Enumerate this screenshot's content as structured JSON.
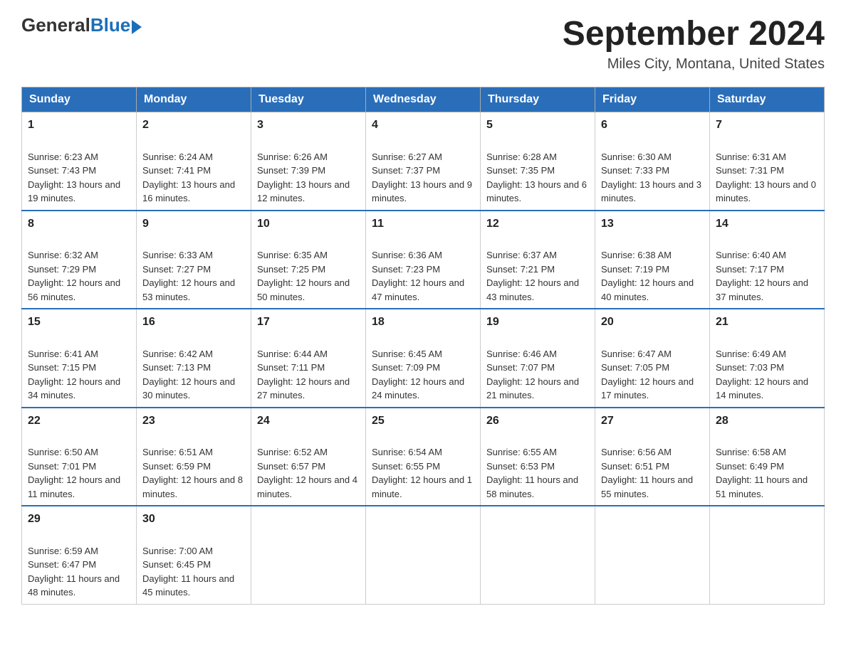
{
  "logo": {
    "general": "General",
    "blue": "Blue"
  },
  "title": "September 2024",
  "location": "Miles City, Montana, United States",
  "days_of_week": [
    "Sunday",
    "Monday",
    "Tuesday",
    "Wednesday",
    "Thursday",
    "Friday",
    "Saturday"
  ],
  "weeks": [
    [
      {
        "day": "1",
        "sunrise": "Sunrise: 6:23 AM",
        "sunset": "Sunset: 7:43 PM",
        "daylight": "Daylight: 13 hours and 19 minutes."
      },
      {
        "day": "2",
        "sunrise": "Sunrise: 6:24 AM",
        "sunset": "Sunset: 7:41 PM",
        "daylight": "Daylight: 13 hours and 16 minutes."
      },
      {
        "day": "3",
        "sunrise": "Sunrise: 6:26 AM",
        "sunset": "Sunset: 7:39 PM",
        "daylight": "Daylight: 13 hours and 12 minutes."
      },
      {
        "day": "4",
        "sunrise": "Sunrise: 6:27 AM",
        "sunset": "Sunset: 7:37 PM",
        "daylight": "Daylight: 13 hours and 9 minutes."
      },
      {
        "day": "5",
        "sunrise": "Sunrise: 6:28 AM",
        "sunset": "Sunset: 7:35 PM",
        "daylight": "Daylight: 13 hours and 6 minutes."
      },
      {
        "day": "6",
        "sunrise": "Sunrise: 6:30 AM",
        "sunset": "Sunset: 7:33 PM",
        "daylight": "Daylight: 13 hours and 3 minutes."
      },
      {
        "day": "7",
        "sunrise": "Sunrise: 6:31 AM",
        "sunset": "Sunset: 7:31 PM",
        "daylight": "Daylight: 13 hours and 0 minutes."
      }
    ],
    [
      {
        "day": "8",
        "sunrise": "Sunrise: 6:32 AM",
        "sunset": "Sunset: 7:29 PM",
        "daylight": "Daylight: 12 hours and 56 minutes."
      },
      {
        "day": "9",
        "sunrise": "Sunrise: 6:33 AM",
        "sunset": "Sunset: 7:27 PM",
        "daylight": "Daylight: 12 hours and 53 minutes."
      },
      {
        "day": "10",
        "sunrise": "Sunrise: 6:35 AM",
        "sunset": "Sunset: 7:25 PM",
        "daylight": "Daylight: 12 hours and 50 minutes."
      },
      {
        "day": "11",
        "sunrise": "Sunrise: 6:36 AM",
        "sunset": "Sunset: 7:23 PM",
        "daylight": "Daylight: 12 hours and 47 minutes."
      },
      {
        "day": "12",
        "sunrise": "Sunrise: 6:37 AM",
        "sunset": "Sunset: 7:21 PM",
        "daylight": "Daylight: 12 hours and 43 minutes."
      },
      {
        "day": "13",
        "sunrise": "Sunrise: 6:38 AM",
        "sunset": "Sunset: 7:19 PM",
        "daylight": "Daylight: 12 hours and 40 minutes."
      },
      {
        "day": "14",
        "sunrise": "Sunrise: 6:40 AM",
        "sunset": "Sunset: 7:17 PM",
        "daylight": "Daylight: 12 hours and 37 minutes."
      }
    ],
    [
      {
        "day": "15",
        "sunrise": "Sunrise: 6:41 AM",
        "sunset": "Sunset: 7:15 PM",
        "daylight": "Daylight: 12 hours and 34 minutes."
      },
      {
        "day": "16",
        "sunrise": "Sunrise: 6:42 AM",
        "sunset": "Sunset: 7:13 PM",
        "daylight": "Daylight: 12 hours and 30 minutes."
      },
      {
        "day": "17",
        "sunrise": "Sunrise: 6:44 AM",
        "sunset": "Sunset: 7:11 PM",
        "daylight": "Daylight: 12 hours and 27 minutes."
      },
      {
        "day": "18",
        "sunrise": "Sunrise: 6:45 AM",
        "sunset": "Sunset: 7:09 PM",
        "daylight": "Daylight: 12 hours and 24 minutes."
      },
      {
        "day": "19",
        "sunrise": "Sunrise: 6:46 AM",
        "sunset": "Sunset: 7:07 PM",
        "daylight": "Daylight: 12 hours and 21 minutes."
      },
      {
        "day": "20",
        "sunrise": "Sunrise: 6:47 AM",
        "sunset": "Sunset: 7:05 PM",
        "daylight": "Daylight: 12 hours and 17 minutes."
      },
      {
        "day": "21",
        "sunrise": "Sunrise: 6:49 AM",
        "sunset": "Sunset: 7:03 PM",
        "daylight": "Daylight: 12 hours and 14 minutes."
      }
    ],
    [
      {
        "day": "22",
        "sunrise": "Sunrise: 6:50 AM",
        "sunset": "Sunset: 7:01 PM",
        "daylight": "Daylight: 12 hours and 11 minutes."
      },
      {
        "day": "23",
        "sunrise": "Sunrise: 6:51 AM",
        "sunset": "Sunset: 6:59 PM",
        "daylight": "Daylight: 12 hours and 8 minutes."
      },
      {
        "day": "24",
        "sunrise": "Sunrise: 6:52 AM",
        "sunset": "Sunset: 6:57 PM",
        "daylight": "Daylight: 12 hours and 4 minutes."
      },
      {
        "day": "25",
        "sunrise": "Sunrise: 6:54 AM",
        "sunset": "Sunset: 6:55 PM",
        "daylight": "Daylight: 12 hours and 1 minute."
      },
      {
        "day": "26",
        "sunrise": "Sunrise: 6:55 AM",
        "sunset": "Sunset: 6:53 PM",
        "daylight": "Daylight: 11 hours and 58 minutes."
      },
      {
        "day": "27",
        "sunrise": "Sunrise: 6:56 AM",
        "sunset": "Sunset: 6:51 PM",
        "daylight": "Daylight: 11 hours and 55 minutes."
      },
      {
        "day": "28",
        "sunrise": "Sunrise: 6:58 AM",
        "sunset": "Sunset: 6:49 PM",
        "daylight": "Daylight: 11 hours and 51 minutes."
      }
    ],
    [
      {
        "day": "29",
        "sunrise": "Sunrise: 6:59 AM",
        "sunset": "Sunset: 6:47 PM",
        "daylight": "Daylight: 11 hours and 48 minutes."
      },
      {
        "day": "30",
        "sunrise": "Sunrise: 7:00 AM",
        "sunset": "Sunset: 6:45 PM",
        "daylight": "Daylight: 11 hours and 45 minutes."
      },
      null,
      null,
      null,
      null,
      null
    ]
  ]
}
